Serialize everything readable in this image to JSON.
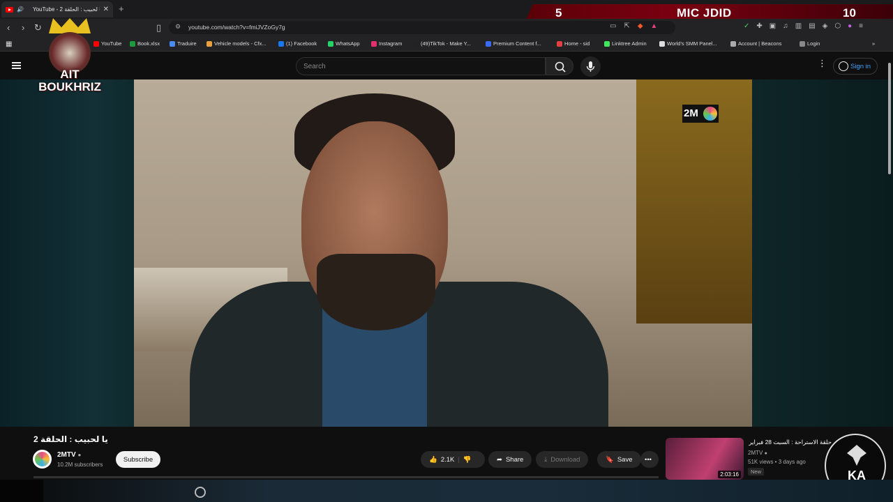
{
  "browser": {
    "tab_title": "YouTube - يا لحبيب : الحلقة 2",
    "url": "youtube.com/watch?v=fmiJVZoGy7g",
    "bookmarks": [
      {
        "label": "YouTube",
        "color": "#ff0000"
      },
      {
        "label": "Book.xlsx",
        "color": "#1d9a3e"
      },
      {
        "label": "Traduire",
        "color": "#4a8af4"
      },
      {
        "label": "Vehicle models - Cfx...",
        "color": "#e8a040"
      },
      {
        "label": "(1) Facebook",
        "color": "#1877f2"
      },
      {
        "label": "WhatsApp",
        "color": "#25d366"
      },
      {
        "label": "Instagram",
        "color": "#e1306c"
      },
      {
        "label": "(49)TikTok - Make Y...",
        "color": "#222222"
      },
      {
        "label": "Premium Content f...",
        "color": "#3a6af4"
      },
      {
        "label": "Home - sid",
        "color": "#e04040"
      },
      {
        "label": "Linktree Admin",
        "color": "#43e55e"
      },
      {
        "label": "World's SMM Panel...",
        "color": "#dddddd"
      },
      {
        "label": "Account | Beacons",
        "color": "#aaaaaa"
      },
      {
        "label": "Login",
        "color": "#888888"
      }
    ]
  },
  "overlay": {
    "left_number": "5",
    "title": "MIC JDID",
    "right_number": "10"
  },
  "masthead": {
    "search_placeholder": "Search",
    "signin_label": "Sign in"
  },
  "video": {
    "title": "يا لحبيب : الحلقة 2",
    "channel_watermark": "2M",
    "channel": "2MTV",
    "subscribers": "10.2M subscribers",
    "subscribe_label": "Subscribe",
    "likes": "2.1K",
    "share_label": "Share",
    "download_label": "Download",
    "save_label": "Save",
    "more": "•••"
  },
  "recommendation": {
    "title": "حلقة الاستراحة : السبت 28 فبراير 2026",
    "channel": "2MTV",
    "meta": "51K views • 3 days ago",
    "badge": "New",
    "duration": "2:03:16"
  },
  "logos": {
    "left_text_1": "AIT",
    "left_text_2": "BOUKHRIZ",
    "right_text": "KA"
  },
  "colors": {
    "youtube_red": "#ff0000",
    "link_blue": "#3ea6ff",
    "overlay_red": "#7a0010"
  }
}
